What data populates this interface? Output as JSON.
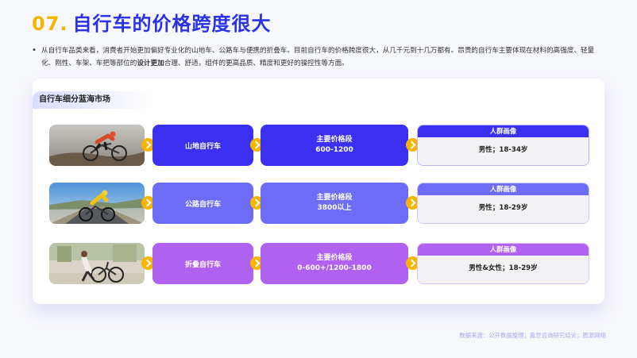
{
  "title": {
    "number": "07.",
    "text": "自行车的价格跨度很大"
  },
  "intro": {
    "part1": "从自行车品类来看，消费者开始更加偏好专业化的山地车、公路车与便携的折叠车。目前自行车的价格跨度很大，从几千元到十几万都有。昂贵的自行车主要体现在材料的高强度、轻量化、刚性、车架、车把等部位的",
    "bold": "设计更加",
    "part2": "合理、舒适，组件的更高品质、精度和更好的操控性等方面。"
  },
  "card": {
    "tag": "自行车细分蓝海市场",
    "rows": [
      {
        "type": "山地自行车",
        "price_label": "主要价格段",
        "price_value": "600-1200",
        "persona_label": "人群画像",
        "persona_value": "男性；18-34岁",
        "color": "#3b2ff0",
        "photo_icon": "mountain-biker-photo"
      },
      {
        "type": "公路自行车",
        "price_label": "主要价格段",
        "price_value": "3800以上",
        "persona_label": "人群画像",
        "persona_value": "男性；18-29岁",
        "color": "#6d6cf6",
        "photo_icon": "road-cyclist-photo"
      },
      {
        "type": "折叠自行车",
        "price_label": "主要价格段",
        "price_value": "0-600+/1200-1800",
        "persona_label": "人群画像",
        "persona_value": "男性&女性；18-29岁",
        "color": "#b061ef",
        "photo_icon": "folding-bike-photo"
      }
    ]
  },
  "footer": "数据来源：公开数据整理；嘉世咨询研究结论；图源网络"
}
